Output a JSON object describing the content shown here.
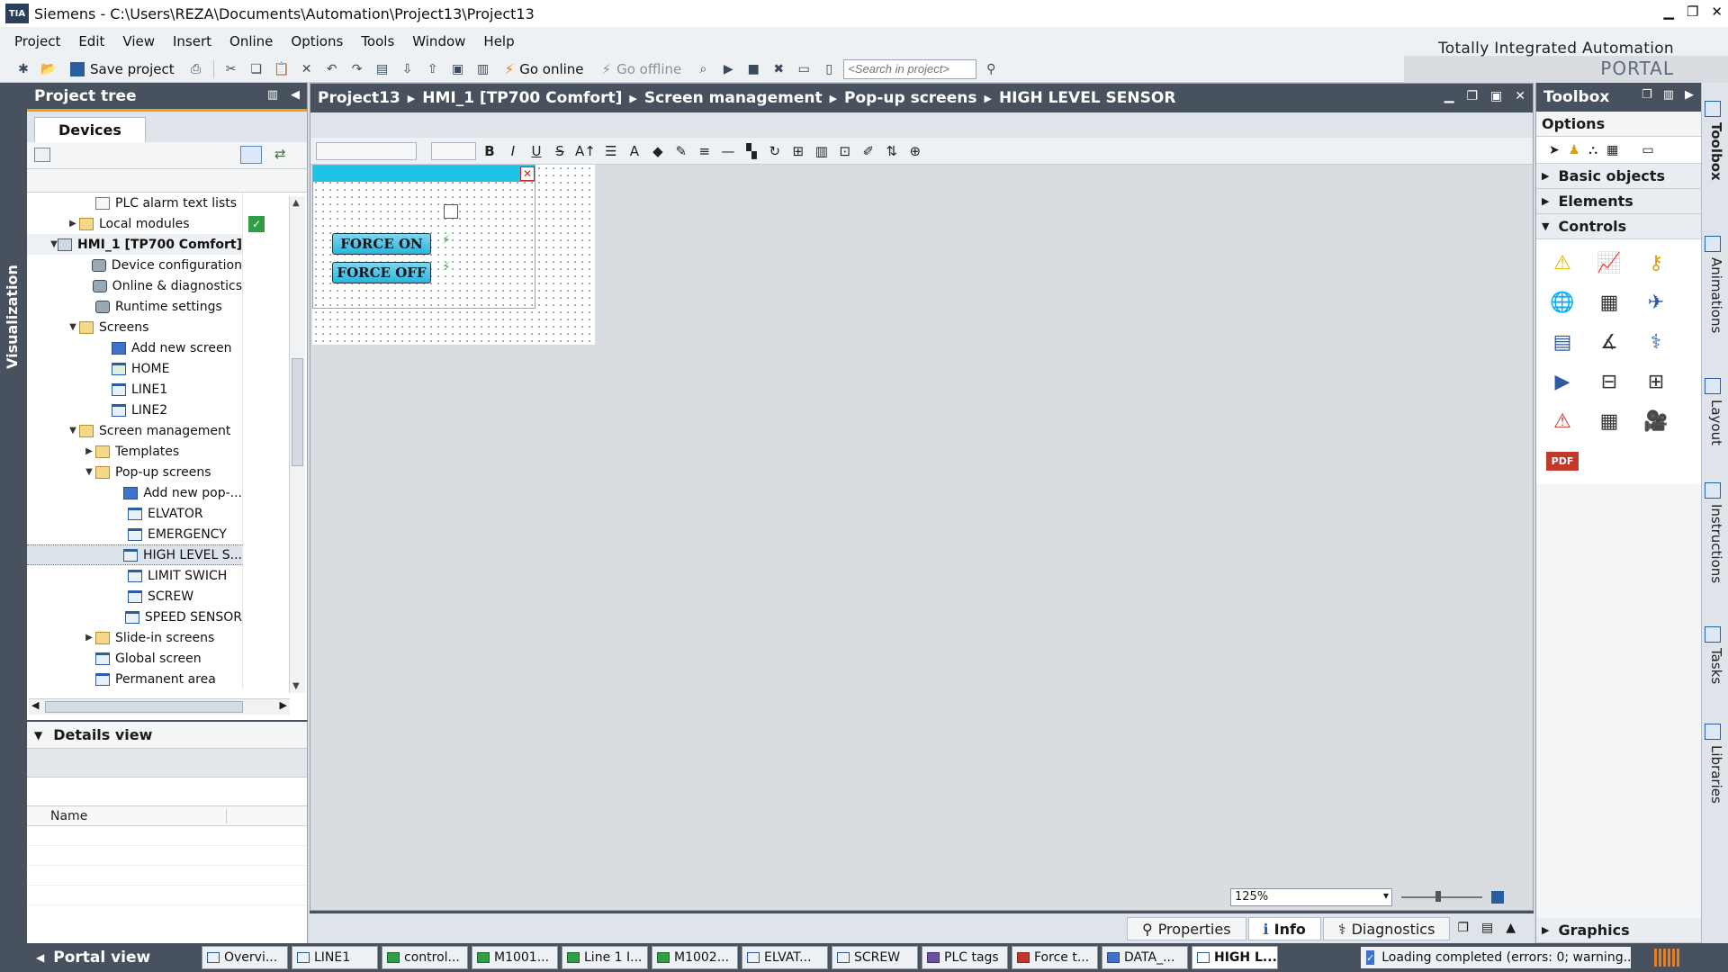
{
  "window": {
    "app_badge": "TIA",
    "title": "Siemens  -  C:\\Users\\REZA\\Documents\\Automation\\Project13\\Project13"
  },
  "menu": [
    "Project",
    "Edit",
    "View",
    "Insert",
    "Online",
    "Options",
    "Tools",
    "Window",
    "Help"
  ],
  "brand": {
    "line1": "Totally Integrated Automation",
    "line2": "PORTAL"
  },
  "toolbar": {
    "save_label": "Save project",
    "go_online": "Go online",
    "go_offline": "Go offline",
    "search_placeholder": "<Search in project>"
  },
  "visualization_tab": "Visualization",
  "project_tree": {
    "title": "Project tree",
    "devices_tab": "Devices",
    "items": [
      {
        "label": "PLC alarm text lists",
        "indent": 3,
        "icon": "doc",
        "arrow": ""
      },
      {
        "label": "Local modules",
        "indent": 2,
        "icon": "folder",
        "arrow": "▶",
        "check": true
      },
      {
        "label": "HMI_1 [TP700 Comfort]",
        "indent": 1,
        "icon": "plc",
        "arrow": "▼",
        "bold": true
      },
      {
        "label": "Device configuration",
        "indent": 3,
        "icon": "gear",
        "arrow": ""
      },
      {
        "label": "Online & diagnostics",
        "indent": 3,
        "icon": "gear",
        "arrow": ""
      },
      {
        "label": "Runtime settings",
        "indent": 3,
        "icon": "gear",
        "arrow": ""
      },
      {
        "label": "Screens",
        "indent": 2,
        "icon": "folder",
        "arrow": "▼"
      },
      {
        "label": "Add new screen",
        "indent": 4,
        "icon": "add",
        "arrow": ""
      },
      {
        "label": "HOME",
        "indent": 4,
        "icon": "home",
        "arrow": ""
      },
      {
        "label": "LINE1",
        "indent": 4,
        "icon": "screen",
        "arrow": ""
      },
      {
        "label": "LINE2",
        "indent": 4,
        "icon": "screen",
        "arrow": ""
      },
      {
        "label": "Screen management",
        "indent": 2,
        "icon": "folder",
        "arrow": "▼"
      },
      {
        "label": "Templates",
        "indent": 3,
        "icon": "folder",
        "arrow": "▶"
      },
      {
        "label": "Pop-up screens",
        "indent": 3,
        "icon": "folder",
        "arrow": "▼"
      },
      {
        "label": "Add new pop-...",
        "indent": 5,
        "icon": "add",
        "arrow": ""
      },
      {
        "label": "ELVATOR",
        "indent": 5,
        "icon": "screen",
        "arrow": ""
      },
      {
        "label": "EMERGENCY",
        "indent": 5,
        "icon": "screen",
        "arrow": ""
      },
      {
        "label": "HIGH LEVEL S...",
        "indent": 5,
        "icon": "screen",
        "arrow": "",
        "selected": true
      },
      {
        "label": "LIMIT SWICH",
        "indent": 5,
        "icon": "screen",
        "arrow": ""
      },
      {
        "label": "SCREW",
        "indent": 5,
        "icon": "screen",
        "arrow": ""
      },
      {
        "label": "SPEED SENSOR",
        "indent": 5,
        "icon": "screen",
        "arrow": ""
      },
      {
        "label": "Slide-in screens",
        "indent": 3,
        "icon": "folder",
        "arrow": "▶"
      },
      {
        "label": "Global screen",
        "indent": 3,
        "icon": "screen",
        "arrow": ""
      },
      {
        "label": "Permanent area",
        "indent": 3,
        "icon": "screen",
        "arrow": ""
      }
    ]
  },
  "details": {
    "title": "Details view",
    "name_col": "Name"
  },
  "editor": {
    "breadcrumb": [
      "Project13",
      "HMI_1 [TP700 Comfort]",
      "Screen management",
      "Pop-up screens",
      "HIGH LEVEL SENSOR"
    ],
    "buttons": {
      "force_on": "FORCE ON",
      "force_off": "FORCE OFF"
    },
    "zoom": "125%"
  },
  "inspector_tabs": {
    "properties": "Properties",
    "info": "Info",
    "diagnostics": "Diagnostics"
  },
  "toolbox": {
    "title": "Toolbox",
    "options": "Options",
    "basic_objects": "Basic objects",
    "elements": "Elements",
    "controls": "Controls",
    "graphics": "Graphics",
    "pdf_label": "PDF"
  },
  "right_tabs": [
    "Toolbox",
    "Animations",
    "Layout",
    "Instructions",
    "Tasks",
    "Libraries"
  ],
  "taskbar": {
    "portal_view": "Portal view",
    "tasks": [
      "Overvi...",
      "LINE1",
      "control...",
      "M1001...",
      "Line 1 I...",
      "M1002...",
      "ELVAT...",
      "SCREW",
      "PLC tags",
      "Force t...",
      "DATA_...",
      "HIGH L..."
    ],
    "status": "Loading completed (errors: 0; warning..."
  }
}
